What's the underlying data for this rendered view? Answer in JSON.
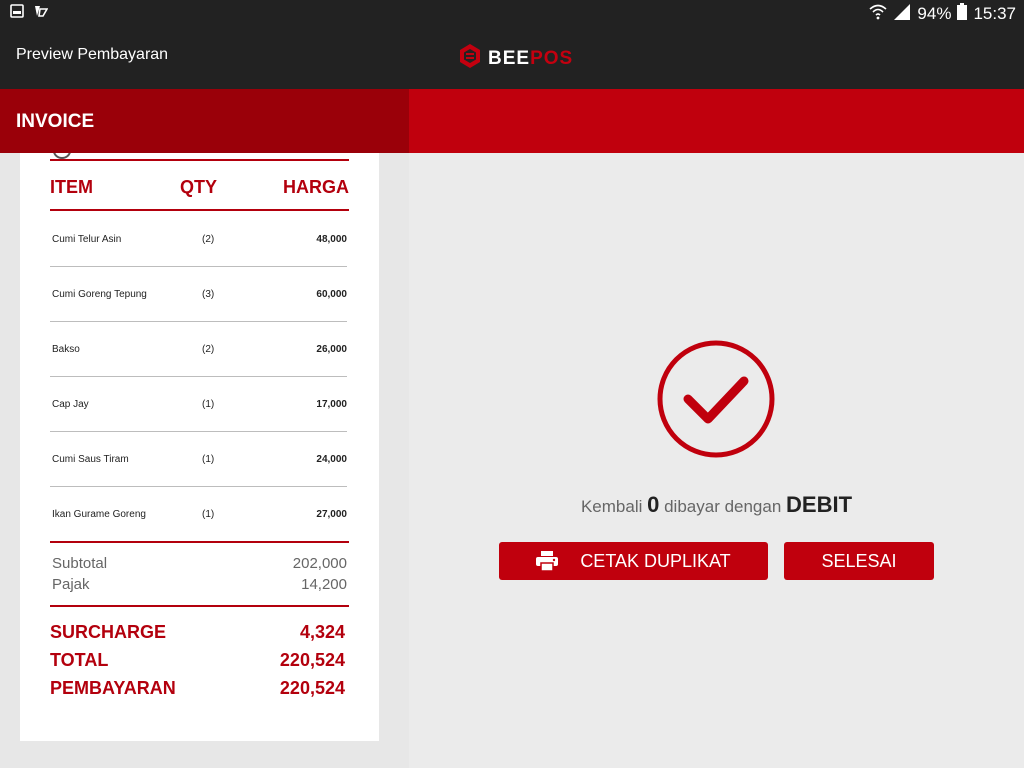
{
  "status_bar": {
    "battery": "94%",
    "time": "15:37",
    "left_icons": [
      "image-notification-icon",
      "app-notification-icon"
    ],
    "right_icons": [
      "wifi-icon",
      "signal-icon",
      "battery-icon"
    ]
  },
  "app_bar": {
    "title": "Preview Pembayaran",
    "logo_part1": "BEE",
    "logo_part2": "POS"
  },
  "invoice": {
    "title": "INVOICE",
    "headers": {
      "item": "ITEM",
      "qty": "QTY",
      "price": "HARGA"
    },
    "rows": [
      {
        "name": "Cumi Telur Asin",
        "qty": "(2)",
        "price": "48,000"
      },
      {
        "name": "Cumi Goreng Tepung",
        "qty": "(3)",
        "price": "60,000"
      },
      {
        "name": "Bakso",
        "qty": "(2)",
        "price": "26,000"
      },
      {
        "name": "Cap Jay",
        "qty": "(1)",
        "price": "17,000"
      },
      {
        "name": "Cumi Saus Tiram",
        "qty": "(1)",
        "price": "24,000"
      },
      {
        "name": "Ikan Gurame Goreng",
        "qty": "(1)",
        "price": "27,000"
      }
    ],
    "subtotal_label": "Subtotal",
    "subtotal_value": "202,000",
    "tax_label": "Pajak",
    "tax_value": "14,200",
    "surcharge_label": "SURCHARGE",
    "surcharge_value": "4,324",
    "total_label": "TOTAL",
    "total_value": "220,524",
    "payment_label": "PEMBAYARAN",
    "payment_value": "220,524"
  },
  "result": {
    "kembali_label": "Kembali",
    "change_amount": "0",
    "paid_with_label": "dibayar dengan",
    "payment_method": "DEBIT",
    "print_button": "CETAK DUPLIKAT",
    "done_button": "SELESAI"
  },
  "colors": {
    "brand_red": "#c0000d",
    "dark_red": "#9a0009",
    "bar_dark": "#222222"
  }
}
